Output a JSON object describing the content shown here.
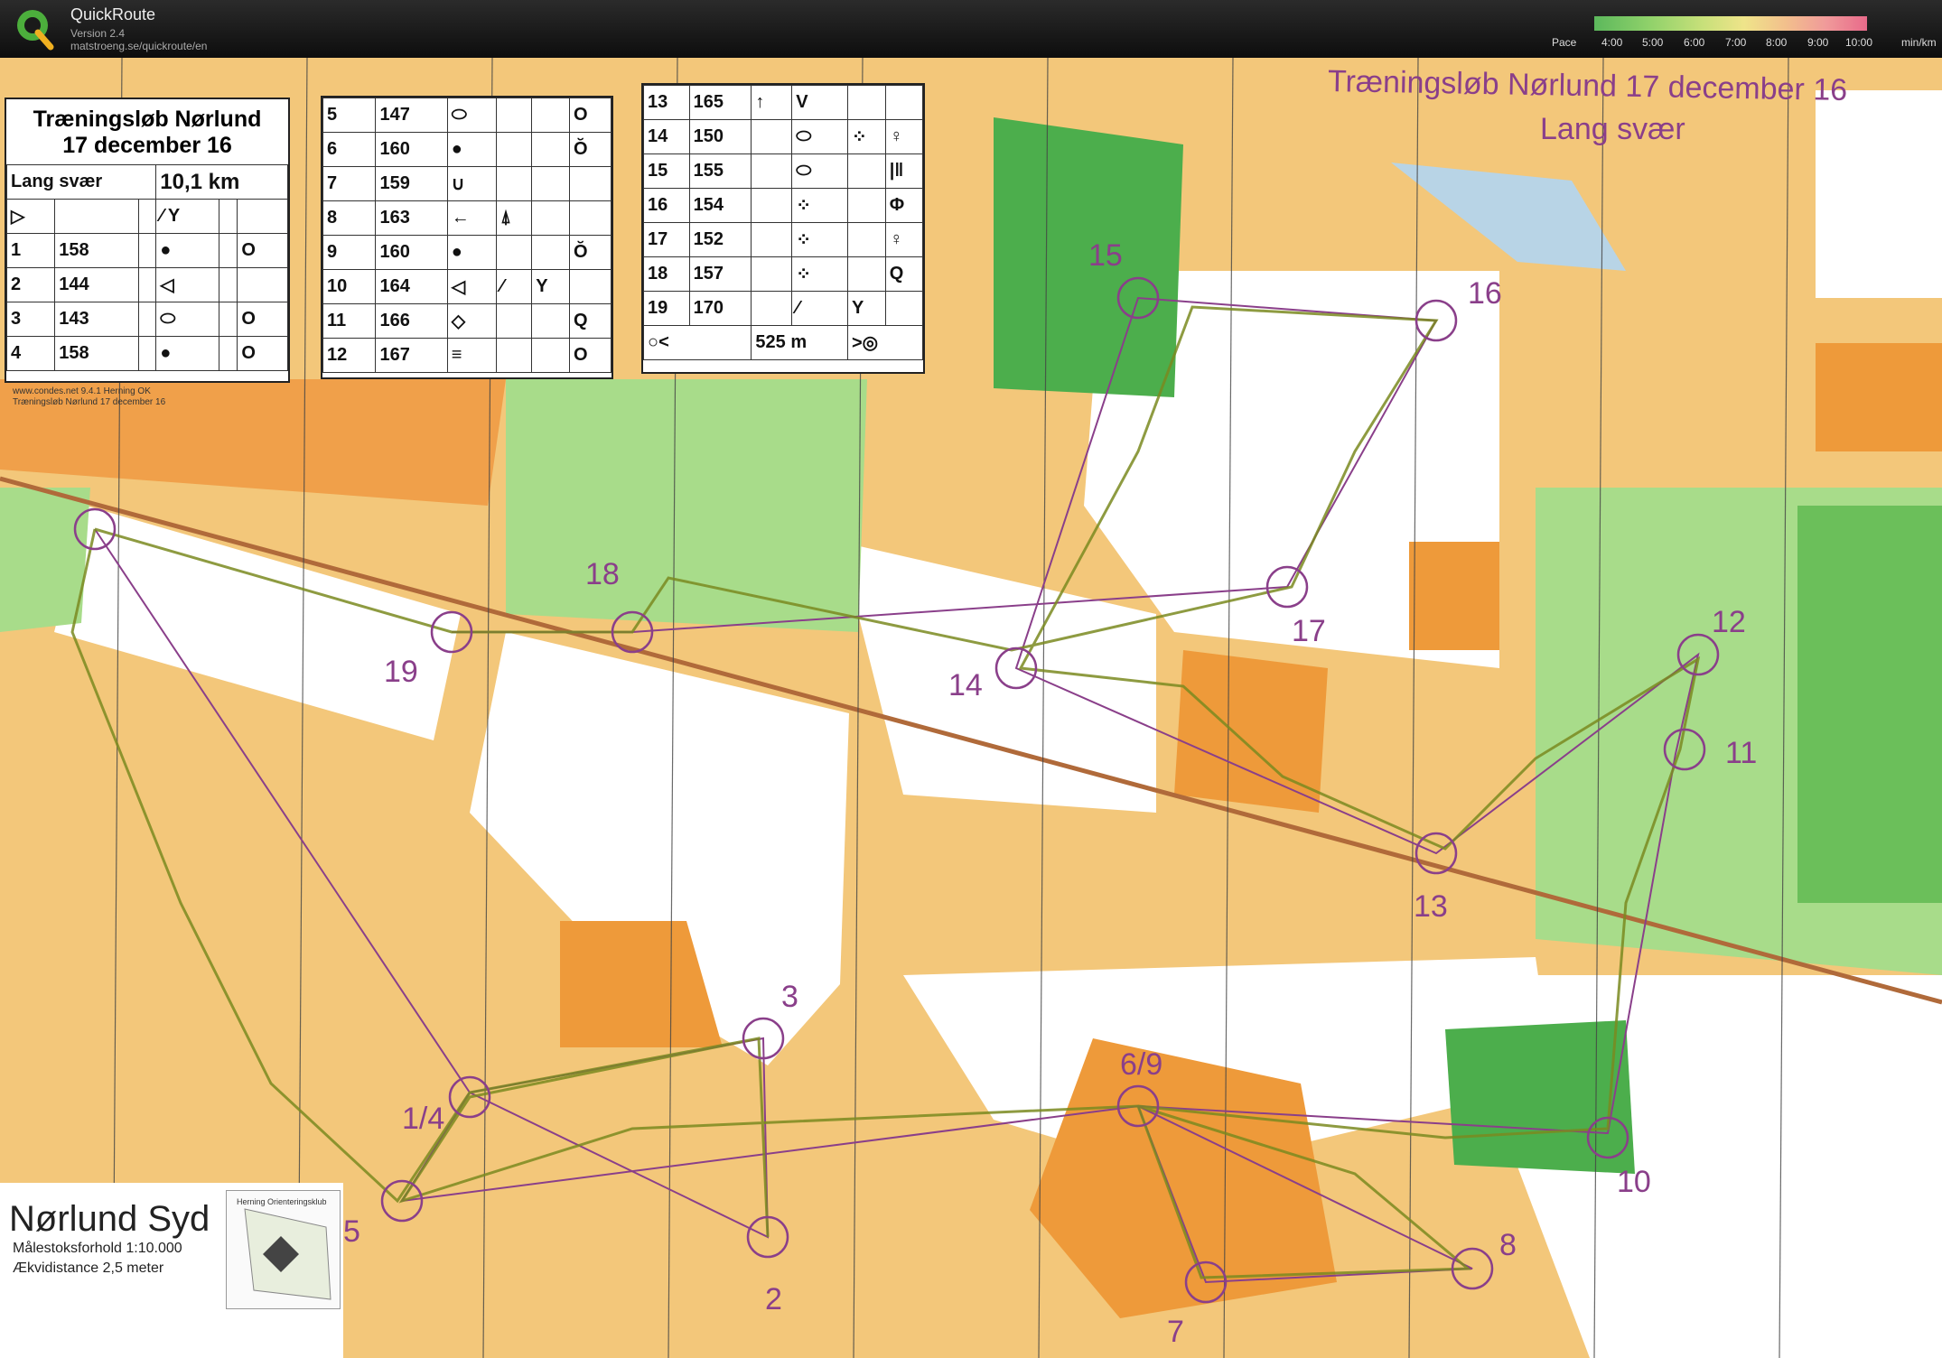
{
  "app": {
    "title": "QuickRoute",
    "version": "Version 2.4",
    "url": "matstroeng.se/quickroute/en",
    "pace_label": "Pace",
    "pace_ticks": [
      "4:00",
      "5:00",
      "6:00",
      "7:00",
      "8:00",
      "9:00",
      "10:00"
    ],
    "pace_unit": "min/km"
  },
  "map": {
    "title": "Træningsløb Nørlund 17 december 16",
    "subtitle": "Lang svær",
    "print_info_1": "www.condes.net 9.4.1 Herning OK",
    "print_info_2": "Træningsløb Nørlund 17 december 16",
    "sheet_name": "Nørlund Syd",
    "scale": "Målestoksforhold 1:10.000",
    "contour": "Ækvidistance 2,5 meter",
    "club_label": "Herning Orienteringsklub"
  },
  "description_sheet": {
    "title_line1": "Træningsløb Nørlund",
    "title_line2": "17 december 16",
    "course_name": "Lang svær",
    "course_length": "10,1 km",
    "finish_distance": "525 m",
    "controls": [
      {
        "num": "1",
        "code": "158"
      },
      {
        "num": "2",
        "code": "144"
      },
      {
        "num": "3",
        "code": "143"
      },
      {
        "num": "4",
        "code": "158"
      },
      {
        "num": "5",
        "code": "147"
      },
      {
        "num": "6",
        "code": "160"
      },
      {
        "num": "7",
        "code": "159"
      },
      {
        "num": "8",
        "code": "163"
      },
      {
        "num": "9",
        "code": "160"
      },
      {
        "num": "10",
        "code": "164"
      },
      {
        "num": "11",
        "code": "166"
      },
      {
        "num": "12",
        "code": "167"
      },
      {
        "num": "13",
        "code": "165"
      },
      {
        "num": "14",
        "code": "150"
      },
      {
        "num": "15",
        "code": "155"
      },
      {
        "num": "16",
        "code": "154"
      },
      {
        "num": "17",
        "code": "152"
      },
      {
        "num": "18",
        "code": "157"
      },
      {
        "num": "19",
        "code": "170"
      }
    ]
  },
  "control_labels": [
    "15",
    "16",
    "18",
    "17",
    "12",
    "19",
    "14",
    "11",
    "13",
    "3",
    "6/9",
    "1/4",
    "10",
    "5",
    "8",
    "2",
    "7"
  ],
  "colors": {
    "course": "#8a3f8a",
    "open": "#f3c77a",
    "rough": "#ee9a3a",
    "forest_green": "#4cae4c",
    "light_green": "#a8dc8a",
    "white_forest": "#ffffff"
  }
}
